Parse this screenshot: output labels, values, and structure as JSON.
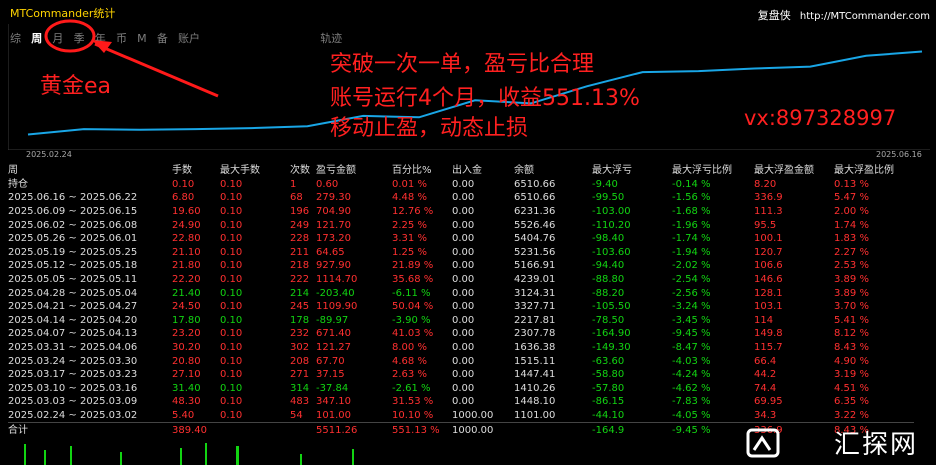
{
  "window": {
    "title": "MTCommander统计",
    "brand_name": "复盘侠",
    "brand_url": "http://MTCommander.com"
  },
  "tabs": [
    {
      "label": "综"
    },
    {
      "label": "周"
    },
    {
      "label": "月"
    },
    {
      "label": "季"
    },
    {
      "label": "年"
    },
    {
      "label": "币"
    },
    {
      "label": "M"
    },
    {
      "label": "备"
    },
    {
      "label": "账户"
    },
    {
      "label": "轨迹"
    }
  ],
  "chart_data": {
    "type": "line",
    "x_start": "2025.02.24",
    "x_end": "2025.06.16",
    "series": [
      {
        "color": "#19a6e6",
        "x": [
          "2025.02.24",
          "2025.03.03",
          "2025.03.10",
          "2025.03.17",
          "2025.03.24",
          "2025.03.31",
          "2025.04.07",
          "2025.04.14",
          "2025.04.21",
          "2025.04.28",
          "2025.05.05",
          "2025.05.12",
          "2025.05.19",
          "2025.05.26",
          "2025.06.02",
          "2025.06.09",
          "2025.06.16"
        ],
        "values": [
          1101.0,
          1448.1,
          1410.26,
          1447.41,
          1515.11,
          1636.38,
          2307.78,
          2217.81,
          3327.71,
          3124.31,
          4239.01,
          5166.91,
          5231.56,
          5404.76,
          5526.46,
          6231.36,
          6510.66
        ]
      }
    ],
    "ylim": [
      1000,
      7000
    ]
  },
  "annotations": {
    "gold": "黄金ea",
    "line1": "突破一次一单，盈亏比合理",
    "line2": "账号运行4个月，收益551.13%",
    "line3": "移动止盈，动态止损",
    "vx": "vx:897328997"
  },
  "table": {
    "headers": [
      "周",
      "手数",
      "最大手数",
      "次数",
      "盈亏金额",
      "百分比%",
      "出入金",
      "余额",
      "最大浮亏",
      "最大浮亏比例",
      "最大浮盈金额",
      "最大浮盈比例"
    ],
    "rows": [
      {
        "cells": [
          "持仓",
          "0.10",
          "0.10",
          "1",
          "0.60",
          "0.01 %",
          "0.00",
          "6510.66",
          "-9.40",
          "-0.14 %",
          "8.20",
          "0.13 %"
        ],
        "pos": true
      },
      {
        "cells": [
          "2025.06.16 ~ 2025.06.22",
          "6.80",
          "0.10",
          "68",
          "279.30",
          "4.48 %",
          "0.00",
          "6510.66",
          "-99.50",
          "-1.56 %",
          "336.9",
          "5.47 %"
        ],
        "pos": true
      },
      {
        "cells": [
          "2025.06.09 ~ 2025.06.15",
          "19.60",
          "0.10",
          "196",
          "704.90",
          "12.76 %",
          "0.00",
          "6231.36",
          "-103.00",
          "-1.68 %",
          "111.3",
          "2.00 %"
        ],
        "pos": true
      },
      {
        "cells": [
          "2025.06.02 ~ 2025.06.08",
          "24.90",
          "0.10",
          "249",
          "121.70",
          "2.25 %",
          "0.00",
          "5526.46",
          "-110.20",
          "-1.96 %",
          "95.5",
          "1.74 %"
        ],
        "pos": true
      },
      {
        "cells": [
          "2025.05.26 ~ 2025.06.01",
          "22.80",
          "0.10",
          "228",
          "173.20",
          "3.31 %",
          "0.00",
          "5404.76",
          "-98.40",
          "-1.74 %",
          "100.1",
          "1.83 %"
        ],
        "pos": true
      },
      {
        "cells": [
          "2025.05.19 ~ 2025.05.25",
          "21.10",
          "0.10",
          "211",
          "64.65",
          "1.25 %",
          "0.00",
          "5231.56",
          "-103.60",
          "-1.94 %",
          "120.7",
          "2.27 %"
        ],
        "pos": true
      },
      {
        "cells": [
          "2025.05.12 ~ 2025.05.18",
          "21.80",
          "0.10",
          "218",
          "927.90",
          "21.89 %",
          "0.00",
          "5166.91",
          "-94.40",
          "-2.02 %",
          "106.6",
          "2.53 %"
        ],
        "pos": true
      },
      {
        "cells": [
          "2025.05.05 ~ 2025.05.11",
          "22.20",
          "0.10",
          "222",
          "1114.70",
          "35.68 %",
          "0.00",
          "4239.01",
          "-88.80",
          "-2.54 %",
          "146.6",
          "3.89 %"
        ],
        "pos": true
      },
      {
        "cells": [
          "2025.04.28 ~ 2025.05.04",
          "21.40",
          "0.10",
          "214",
          "-203.40",
          "-6.11 %",
          "0.00",
          "3124.31",
          "-88.20",
          "-2.56 %",
          "128.1",
          "3.89 %"
        ],
        "pos": false
      },
      {
        "cells": [
          "2025.04.21 ~ 2025.04.27",
          "24.50",
          "0.10",
          "245",
          "1109.90",
          "50.04 %",
          "0.00",
          "3327.71",
          "-105.50",
          "-3.24 %",
          "103.1",
          "3.70 %"
        ],
        "pos": true
      },
      {
        "cells": [
          "2025.04.14 ~ 2025.04.20",
          "17.80",
          "0.10",
          "178",
          "-89.97",
          "-3.90 %",
          "0.00",
          "2217.81",
          "-78.50",
          "-3.45 %",
          "114",
          "5.41 %"
        ],
        "pos": false
      },
      {
        "cells": [
          "2025.04.07 ~ 2025.04.13",
          "23.20",
          "0.10",
          "232",
          "671.40",
          "41.03 %",
          "0.00",
          "2307.78",
          "-164.90",
          "-9.45 %",
          "149.8",
          "8.12 %"
        ],
        "pos": true
      },
      {
        "cells": [
          "2025.03.31 ~ 2025.04.06",
          "30.20",
          "0.10",
          "302",
          "121.27",
          "8.00 %",
          "0.00",
          "1636.38",
          "-149.30",
          "-8.47 %",
          "115.7",
          "8.43 %"
        ],
        "pos": true
      },
      {
        "cells": [
          "2025.03.24 ~ 2025.03.30",
          "20.80",
          "0.10",
          "208",
          "67.70",
          "4.68 %",
          "0.00",
          "1515.11",
          "-63.60",
          "-4.03 %",
          "66.4",
          "4.90 %"
        ],
        "pos": true
      },
      {
        "cells": [
          "2025.03.17 ~ 2025.03.23",
          "27.10",
          "0.10",
          "271",
          "37.15",
          "2.63 %",
          "0.00",
          "1447.41",
          "-58.80",
          "-4.24 %",
          "44.2",
          "3.19 %"
        ],
        "pos": true
      },
      {
        "cells": [
          "2025.03.10 ~ 2025.03.16",
          "31.40",
          "0.10",
          "314",
          "-37.84",
          "-2.61 %",
          "0.00",
          "1410.26",
          "-57.80",
          "-4.62 %",
          "74.4",
          "4.51 %"
        ],
        "pos": false
      },
      {
        "cells": [
          "2025.03.03 ~ 2025.03.09",
          "48.30",
          "0.10",
          "483",
          "347.10",
          "31.53 %",
          "0.00",
          "1448.10",
          "-86.15",
          "-7.83 %",
          "69.95",
          "6.35 %"
        ],
        "pos": true
      },
      {
        "cells": [
          "2025.02.24 ~ 2025.03.02",
          "5.40",
          "0.10",
          "54",
          "101.00",
          "10.10 %",
          "1000.00",
          "1101.00",
          "-44.10",
          "-4.05 %",
          "34.3",
          "3.22 %"
        ],
        "pos": true
      }
    ],
    "total": [
      "合计",
      "389.40",
      "",
      "",
      "5511.26",
      "551.13 %",
      "1000.00",
      "",
      "-164.9",
      "-9.45 %",
      "336.9",
      "8.43 %"
    ]
  },
  "watermark": "汇探网"
}
